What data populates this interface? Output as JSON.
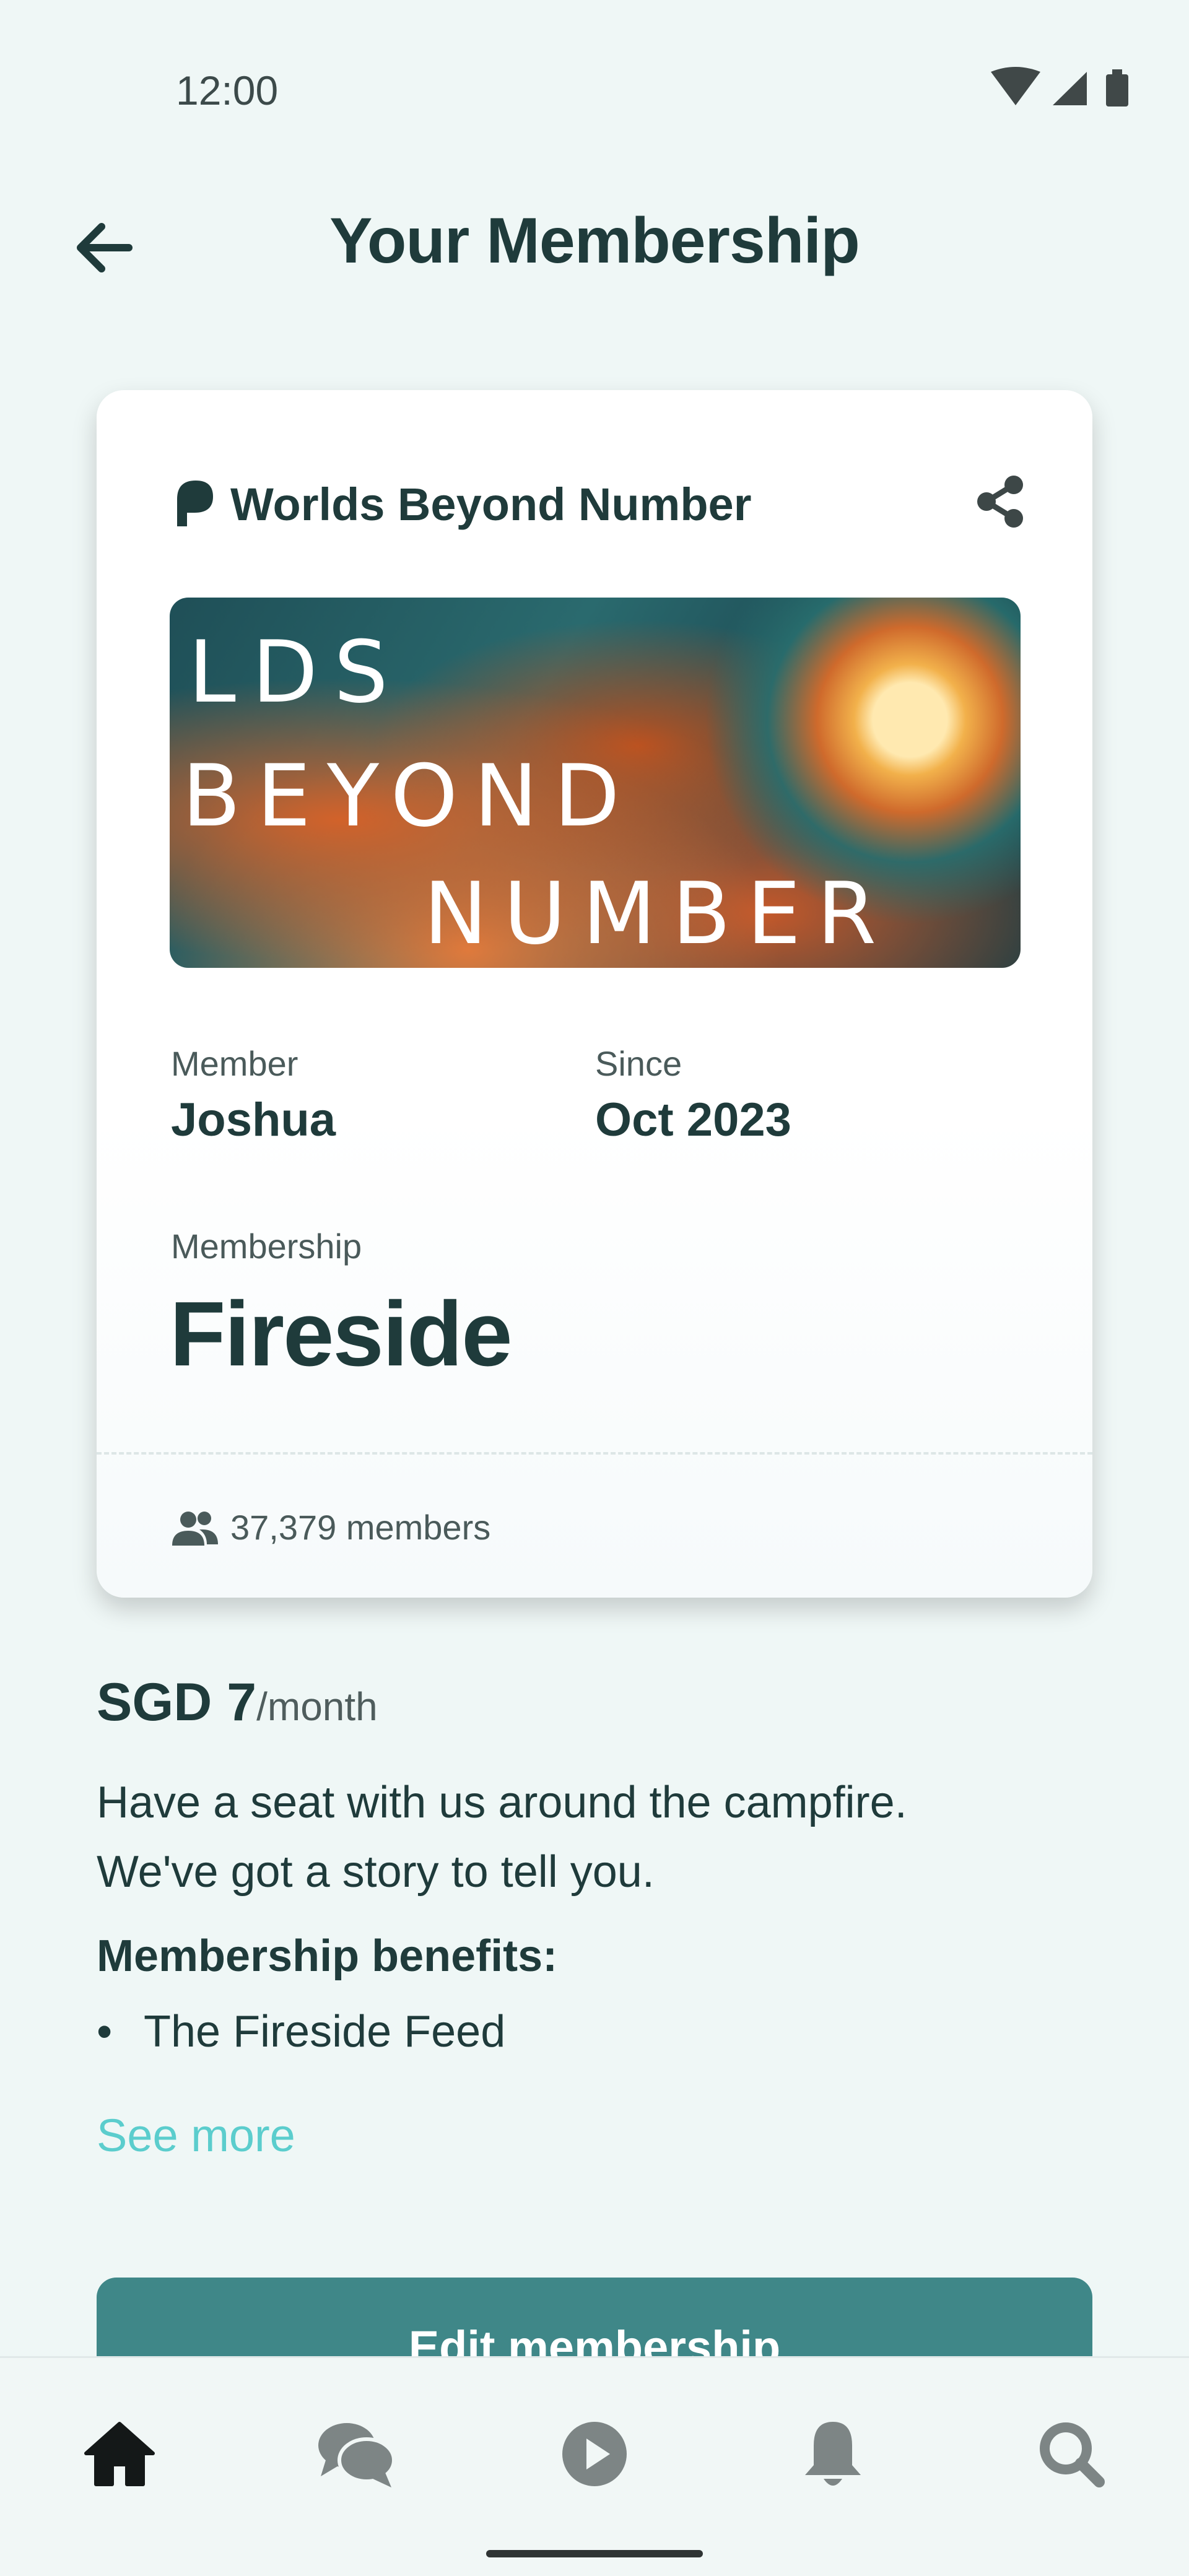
{
  "status_bar": {
    "time": "12:00",
    "icons": [
      "wifi-icon",
      "cell-signal-icon",
      "battery-icon"
    ]
  },
  "header": {
    "title": "Your Membership",
    "back_icon": "arrow-left-icon"
  },
  "card": {
    "creator_name": "Worlds Beyond Number",
    "creator_logo_icon": "patreon-logo-icon",
    "share_icon": "share-icon",
    "banner_lines": [
      "LDS",
      "BEYOND",
      "NUMBER"
    ],
    "member_label": "Member",
    "member_value": "Joshua",
    "since_label": "Since",
    "since_value": "Oct 2023",
    "membership_label": "Membership",
    "tier_name": "Fireside",
    "members_count": "37,379 members",
    "members_icon": "people-icon"
  },
  "details": {
    "price_amount": "SGD 7",
    "price_period": "/month",
    "description_line1": "Have a seat with us around the campfire.",
    "description_line2": "We've got a story to tell you.",
    "benefits_title": "Membership benefits:",
    "benefits": [
      "The Fireside Feed"
    ],
    "see_more": "See more"
  },
  "actions": {
    "edit_label": "Edit membership"
  },
  "bottom_nav": {
    "items": [
      "home-icon",
      "chat-icon",
      "play-icon",
      "bell-icon",
      "search-icon"
    ],
    "active": "home-icon"
  },
  "colors": {
    "background": "#eff7f6",
    "text_primary": "#1f3b3b",
    "accent_link": "#5bcdcd",
    "button": "#3f8788"
  }
}
